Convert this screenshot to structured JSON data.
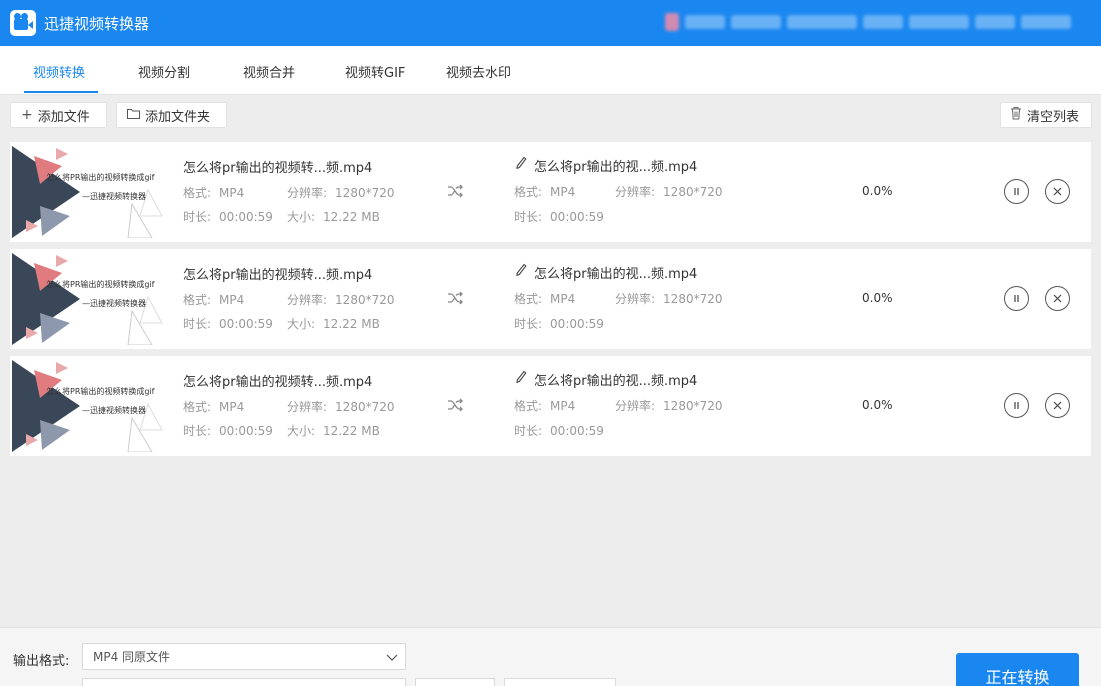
{
  "app": {
    "title": "迅捷视频转换器"
  },
  "tabs": [
    {
      "label": "视频转换",
      "active": true
    },
    {
      "label": "视频分割"
    },
    {
      "label": "视频合并"
    },
    {
      "label": "视频转GIF"
    },
    {
      "label": "视频去水印"
    }
  ],
  "toolbar": {
    "add_file": "添加文件",
    "add_folder": "添加文件夹",
    "clear_list": "清空列表"
  },
  "files": [
    {
      "thumb_line1": "怎么将PR输出的视频转换成gif",
      "thumb_line2": "—迅捷视频转换器",
      "source_name": "怎么将pr输出的视频转...频.mp4",
      "format_label": "格式:",
      "format": "MP4",
      "resolution_label": "分辨率:",
      "resolution": "1280*720",
      "duration_label": "时长:",
      "duration": "00:00:59",
      "size_label": "大小:",
      "size": "12.22 MB",
      "output_name": "怎么将pr输出的视...频.mp4",
      "out_format": "MP4",
      "out_resolution": "1280*720",
      "out_duration": "00:00:59",
      "progress": "0.0%"
    },
    {
      "thumb_line1": "怎么将PR输出的视频转换成gif",
      "thumb_line2": "—迅捷视频转换器",
      "source_name": "怎么将pr输出的视频转...频.mp4",
      "format_label": "格式:",
      "format": "MP4",
      "resolution_label": "分辨率:",
      "resolution": "1280*720",
      "duration_label": "时长:",
      "duration": "00:00:59",
      "size_label": "大小:",
      "size": "12.22 MB",
      "output_name": "怎么将pr输出的视...频.mp4",
      "out_format": "MP4",
      "out_resolution": "1280*720",
      "out_duration": "00:00:59",
      "progress": "0.0%"
    },
    {
      "thumb_line1": "怎么将PR输出的视频转换成gif",
      "thumb_line2": "—迅捷视频转换器",
      "source_name": "怎么将pr输出的视频转...频.mp4",
      "format_label": "格式:",
      "format": "MP4",
      "resolution_label": "分辨率:",
      "resolution": "1280*720",
      "duration_label": "时长:",
      "duration": "00:00:59",
      "size_label": "大小:",
      "size": "12.22 MB",
      "output_name": "怎么将pr输出的视...频.mp4",
      "out_format": "MP4",
      "out_resolution": "1280*720",
      "out_duration": "00:00:59",
      "progress": "0.0%"
    }
  ],
  "output": {
    "label": "输出格式:",
    "selected": "MP4  同原文件"
  },
  "convert_button": "正在转换",
  "colors": {
    "accent": "#1a87f0",
    "background": "#ededed"
  }
}
